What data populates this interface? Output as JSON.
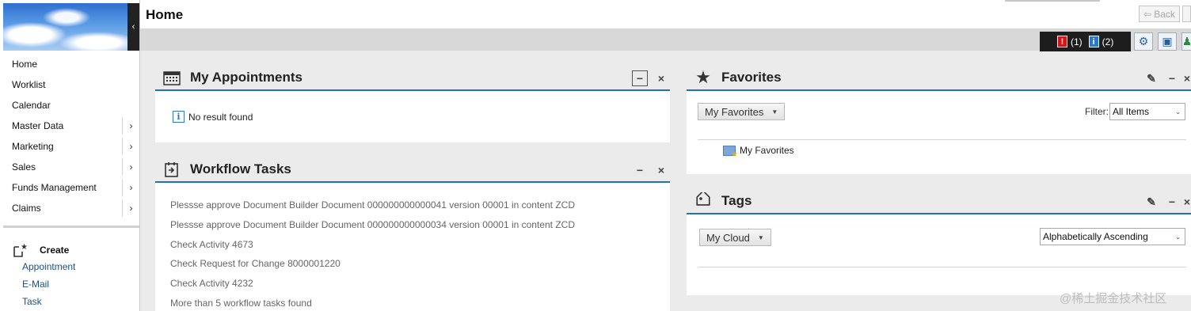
{
  "header": {
    "title": "Home",
    "back_label": "Back"
  },
  "messages": {
    "error_count": "(1)",
    "info_count": "(2)"
  },
  "toolbar": {
    "settings_icon": "gear-icon",
    "personalize_icon": "page-settings-icon",
    "user_icon": "user-icon"
  },
  "sidebar": {
    "items": [
      {
        "label": "Home",
        "has_submenu": false
      },
      {
        "label": "Worklist",
        "has_submenu": false
      },
      {
        "label": "Calendar",
        "has_submenu": false
      },
      {
        "label": "Master Data",
        "has_submenu": true
      },
      {
        "label": "Marketing",
        "has_submenu": true
      },
      {
        "label": "Sales",
        "has_submenu": true
      },
      {
        "label": "Funds Management",
        "has_submenu": true
      },
      {
        "label": "Claims",
        "has_submenu": true
      }
    ],
    "create": {
      "title": "Create",
      "links": [
        "Appointment",
        "E-Mail",
        "Task"
      ]
    }
  },
  "appointments": {
    "title": "My Appointments",
    "empty_text": "No result found"
  },
  "workflow": {
    "title": "Workflow Tasks",
    "tasks": [
      "Plessse approve Document Builder Document 000000000000041 version 00001 in content ZCD",
      "Plessse approve Document Builder Document 000000000000034 version 00001 in content ZCD",
      "Check Activity 4673",
      "Check Request for Change 8000001220",
      "Check Activity 4232",
      "More than 5 workflow tasks found"
    ]
  },
  "favorites": {
    "title": "Favorites",
    "dropdown_label": "My Favorites",
    "filter_label": "Filter:",
    "filter_value": "All Items",
    "item": "My Favorites"
  },
  "tags": {
    "title": "Tags",
    "dropdown_label": "My Cloud",
    "sort_value": "Alphabetically Ascending"
  },
  "watermark": "@稀土掘金技术社区"
}
